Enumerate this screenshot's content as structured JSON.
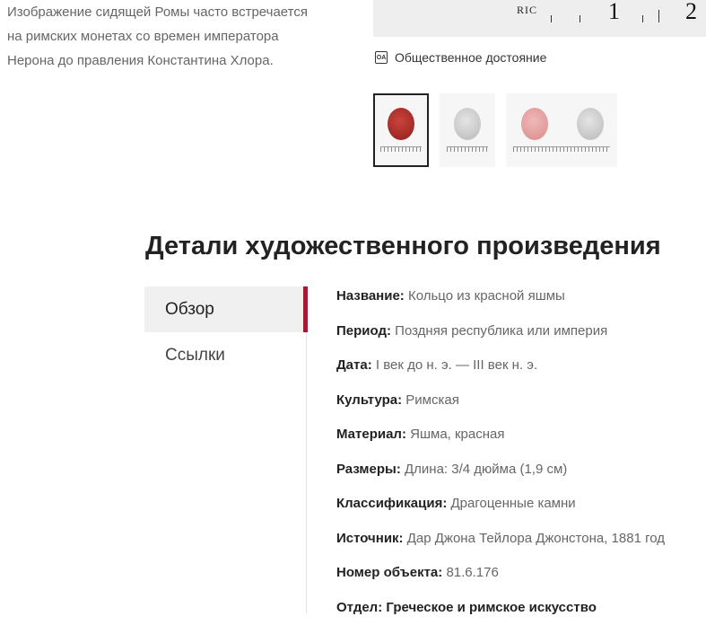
{
  "description": {
    "lines": [
      "Изображение сидящей Ромы часто встречается",
      "на римских монетах со времен императора",
      "Нерона до правления Константина Хлора."
    ]
  },
  "image": {
    "ruler_text": "RIC",
    "ruler_numbers": [
      "1",
      "2"
    ]
  },
  "license": {
    "icon": "OA",
    "text": "Общественное достояние"
  },
  "thumbnails": [
    {
      "name": "thumb-red",
      "color": "#b0302b",
      "selected": true
    },
    {
      "name": "thumb-grey",
      "color": "#cfcfcf",
      "selected": false
    },
    {
      "name": "thumb-pair",
      "colors": [
        "#e6a3a3",
        "#cfcfcf"
      ],
      "selected": false
    }
  ],
  "section": {
    "title": "Детали художественного произведения"
  },
  "nav": {
    "overview": "Обзор",
    "references": "Ссылки",
    "accent": "#a6192e"
  },
  "details": [
    {
      "label": "Название:",
      "value": "Кольцо из красной яшмы"
    },
    {
      "label": "Период:",
      "value": "Поздняя республика или империя"
    },
    {
      "label": "Дата:",
      "value": "I век до н. э. — III век н. э."
    },
    {
      "label": "Культура:",
      "value": "Римская"
    },
    {
      "label": "Материал:",
      "value": "Яшма, красная"
    },
    {
      "label": "Размеры:",
      "value": "Длина: 3/4 дюйма (1,9 см)"
    },
    {
      "label": "Классификация:",
      "value": "Драгоценные камни"
    },
    {
      "label": "Источник:",
      "value": "Дар Джона Тейлора Джонстона, 1881 год"
    },
    {
      "label": "Номер объекта:",
      "value": "81.6.176"
    },
    {
      "label": "Отдел:",
      "value": "Греческое и римское искусство"
    }
  ]
}
